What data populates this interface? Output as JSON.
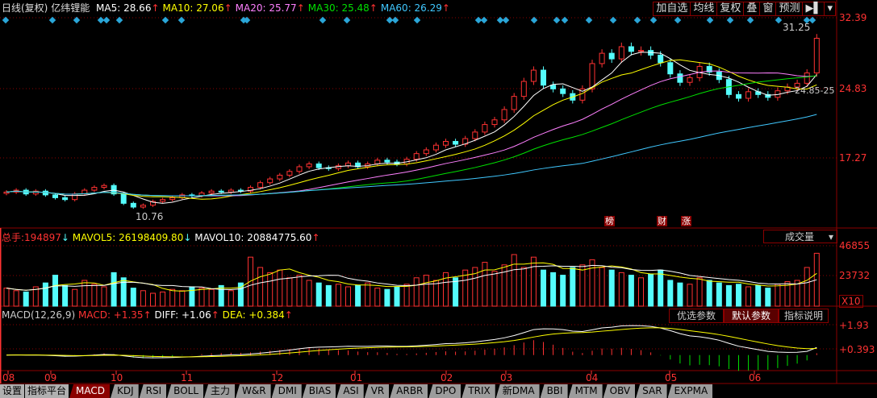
{
  "header": {
    "period": "日线(复权)",
    "stock": "亿纬锂能",
    "ma": [
      {
        "label": "MA5: 28.66",
        "color": "#ffffff"
      },
      {
        "label": "MA10: 27.06",
        "color": "#ffff00"
      },
      {
        "label": "MA20: 25.77",
        "color": "#ff80ff"
      },
      {
        "label": "MA30: 25.48",
        "color": "#00e000"
      },
      {
        "label": "MA60: 26.29",
        "color": "#40c8ff"
      }
    ],
    "buttons": [
      "加自选",
      "均线",
      "复权",
      "叠",
      "窗",
      "预测",
      "▶▌",
      "▾"
    ]
  },
  "price_axis": [
    "32.39",
    "24.83",
    "17.27"
  ],
  "annotations": {
    "high": "31.25",
    "low": "10.76",
    "cost": "24.85-25",
    "markers": [
      "榜",
      "财",
      "涨"
    ]
  },
  "volume": {
    "total_label": "总手:",
    "total": "194897",
    "mavol5": "MAVOL5: 26198409.80",
    "mavol10": "MAVOL10: 20884775.60",
    "select": "成交量",
    "axis": [
      "46855",
      "23732",
      "X10"
    ]
  },
  "macd": {
    "name": "MACD(12,26,9)",
    "macd": "MACD: +1.35",
    "diff": "DIFF: +1.06",
    "dea": "DEA: +0.384",
    "buttons": [
      "优选参数",
      "默认参数",
      "指标说明"
    ],
    "axis": [
      "+1.93",
      "+0.393"
    ]
  },
  "dates": [
    "08",
    "09",
    "10",
    "11",
    "12",
    "01",
    "02",
    "03",
    "04",
    "05",
    "06"
  ],
  "tabs": {
    "buttons": [
      "设置",
      "指标平台"
    ],
    "items": [
      "MACD",
      "KDJ",
      "RSI",
      "BOLL",
      "主力",
      "W&R",
      "DMI",
      "BIAS",
      "ASI",
      "VR",
      "ARBR",
      "DPO",
      "TRIX",
      "新DMA",
      "BBI",
      "MTM",
      "OBV",
      "SAR",
      "EXPMA"
    ],
    "active": "MACD"
  },
  "colors": {
    "up": "#ff3232",
    "down": "#54fcfc",
    "grid": "#8b0000"
  },
  "chart_data": {
    "type": "candlestick",
    "title": "亿纬锂能 日线(复权)",
    "ylim": [
      10.5,
      32.39
    ],
    "close": [
      13.8,
      14.0,
      13.6,
      13.9,
      13.5,
      13.2,
      13.0,
      13.6,
      14.0,
      14.3,
      14.5,
      13.6,
      12.6,
      12.2,
      12.4,
      12.8,
      13.0,
      13.2,
      13.5,
      13.4,
      13.7,
      13.9,
      13.8,
      14.0,
      13.9,
      14.3,
      14.8,
      15.2,
      15.6,
      16.0,
      16.5,
      16.8,
      16.4,
      16.3,
      16.6,
      16.9,
      16.5,
      16.8,
      17.2,
      17.0,
      16.8,
      17.3,
      17.9,
      18.3,
      18.8,
      19.2,
      18.9,
      19.5,
      20.2,
      21.0,
      21.5,
      22.6,
      24.0,
      25.6,
      26.8,
      25.2,
      24.8,
      24.3,
      23.6,
      24.8,
      27.5,
      28.6,
      28.0,
      29.3,
      28.8,
      28.9,
      28.4,
      27.6,
      26.4,
      25.5,
      26.0,
      27.2,
      26.6,
      25.8,
      24.2,
      23.8,
      24.5,
      24.2,
      23.9,
      24.6,
      25.0,
      25.4,
      26.5,
      30.2
    ],
    "volume": [
      14000,
      12000,
      11000,
      15000,
      18000,
      24000,
      16000,
      13000,
      20000,
      17000,
      15000,
      26000,
      22000,
      14000,
      12000,
      10000,
      11000,
      13000,
      12000,
      15000,
      14000,
      13000,
      16000,
      12000,
      18000,
      38000,
      30000,
      26000,
      28000,
      22000,
      24000,
      20000,
      18000,
      16000,
      17000,
      15000,
      16000,
      18000,
      14000,
      13000,
      15000,
      17000,
      22000,
      24000,
      20000,
      26000,
      22000,
      28000,
      30000,
      34000,
      27000,
      32000,
      40000,
      30000,
      38000,
      28000,
      26000,
      24000,
      30000,
      32000,
      36000,
      30000,
      28000,
      26000,
      24000,
      22000,
      25000,
      28000,
      20000,
      18000,
      17000,
      22000,
      20000,
      18000,
      16000,
      17000,
      15000,
      16000,
      14000,
      17000,
      19000,
      20000,
      30000,
      41000
    ]
  }
}
